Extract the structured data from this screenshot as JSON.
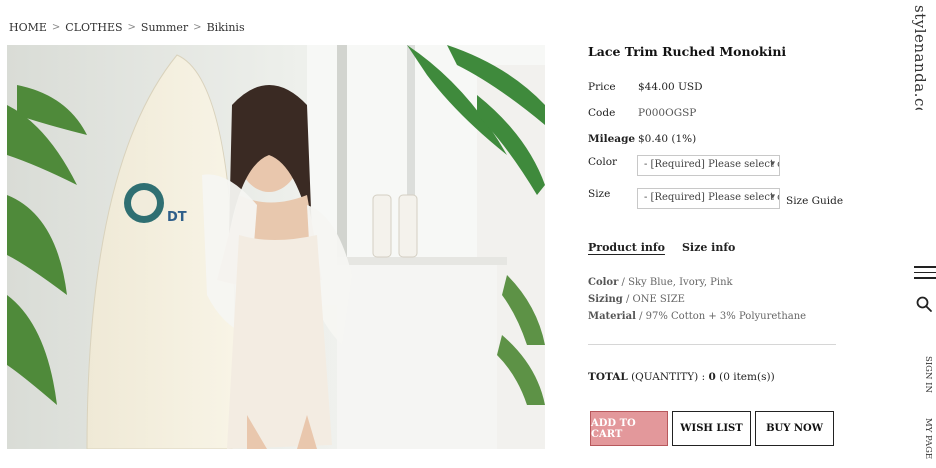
{
  "breadcrumb": {
    "items": [
      "HOME",
      "CLOTHES",
      "Summer",
      "Bikinis"
    ],
    "separator": ">"
  },
  "product": {
    "title": "Lace Trim Ruched Monokini",
    "price_label": "Price",
    "price": "$44.00 USD",
    "code_label": "Code",
    "code": "P000OGSP",
    "mileage_label": "Mileage",
    "mileage": "$0.40 (1%)",
    "color_label": "Color",
    "color_select": "- [Required] Please select opt",
    "size_label": "Size",
    "size_select": "- [Required] Please select opt",
    "size_guide": "Size Guide"
  },
  "tabs": {
    "product_info": "Product info",
    "size_info": "Size info"
  },
  "details": {
    "color_key": "Color",
    "color_value": " / Sky Blue, Ivory, Pink",
    "sizing_key": "Sizing",
    "sizing_value": " / ONE SIZE",
    "material_key": "Material",
    "material_value": " / 97% Cotton + 3% Polyurethane"
  },
  "total": {
    "label": "TOTAL",
    "qty_label": " (QUANTITY) : ",
    "amount": "0",
    "items": " (0 item(s))"
  },
  "buttons": {
    "add_to_cart": "ADD TO CART",
    "wish_list": "WISH LIST",
    "buy_now": "BUY NOW"
  },
  "sidebar": {
    "brand": "stylenanda.com",
    "sign_in": "SIGN IN",
    "my_page": "MY PAGE",
    "menu_icon": "hamburger-icon",
    "search_icon": "search-icon"
  },
  "colors": {
    "cart_button": "#e3989b",
    "text": "#222222",
    "muted": "#666666"
  }
}
